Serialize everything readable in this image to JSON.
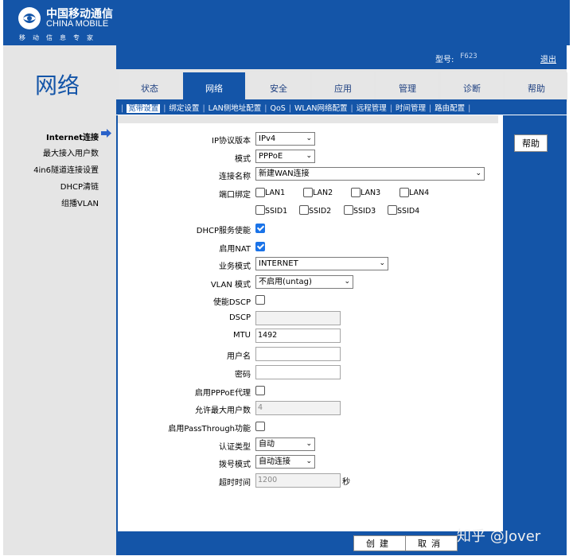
{
  "brand": {
    "name_cn": "中国移动通信",
    "name_en": "CHINA MOBILE",
    "slogan": "移动信息专家"
  },
  "section_title": "网络",
  "header": {
    "model_label": "型号:",
    "model_value": "F623",
    "logout": "退出"
  },
  "tabs": [
    {
      "label": "状态",
      "active": false
    },
    {
      "label": "网络",
      "active": true
    },
    {
      "label": "安全",
      "active": false
    },
    {
      "label": "应用",
      "active": false
    },
    {
      "label": "管理",
      "active": false
    },
    {
      "label": "诊断",
      "active": false
    },
    {
      "label": "帮助",
      "active": false
    }
  ],
  "subnav": [
    "宽带设置",
    "绑定设置",
    "LAN侧地址配置",
    "QoS",
    "WLAN网络配置",
    "远程管理",
    "时间管理",
    "路由配置"
  ],
  "sidebar": [
    {
      "label": "Internet连接",
      "active": true
    },
    {
      "label": "最大接入用户数"
    },
    {
      "label": "4in6隧道连接设置"
    },
    {
      "label": "DHCP清链"
    },
    {
      "label": "组播VLAN"
    }
  ],
  "help_button": "帮助",
  "form": {
    "ip_version": {
      "label": "IP协议版本",
      "value": "IPv4"
    },
    "mode": {
      "label": "模式",
      "value": "PPPoE"
    },
    "conn_name": {
      "label": "连接名称",
      "value": "新建WAN连接"
    },
    "port_binding": {
      "label": "端口绑定",
      "ports": [
        "LAN1",
        "LAN2",
        "LAN3",
        "LAN4"
      ],
      "ssids": [
        "SSID1",
        "SSID2",
        "SSID3",
        "SSID4"
      ]
    },
    "dhcp_service": {
      "label": "DHCP服务使能",
      "checked": true
    },
    "nat": {
      "label": "启用NAT",
      "checked": true
    },
    "service_mode": {
      "label": "业务模式",
      "value": "INTERNET"
    },
    "vlan_mode": {
      "label": "VLAN 模式",
      "value": "不启用(untag)"
    },
    "dscp_enable": {
      "label": "使能DSCP",
      "checked": false
    },
    "dscp": {
      "label": "DSCP",
      "value": ""
    },
    "mtu": {
      "label": "MTU",
      "value": "1492"
    },
    "username": {
      "label": "用户名",
      "value": ""
    },
    "password": {
      "label": "密码",
      "value": ""
    },
    "pppoe_proxy": {
      "label": "启用PPPoE代理",
      "checked": false
    },
    "max_users": {
      "label": "允许最大用户数",
      "value": "4"
    },
    "passthrough": {
      "label": "启用PassThrough功能",
      "checked": false
    },
    "auth_type": {
      "label": "认证类型",
      "value": "自动"
    },
    "dial_mode": {
      "label": "拨号模式",
      "value": "自动连接"
    },
    "timeout": {
      "label": "超时时间",
      "value": "1200",
      "unit": "秒"
    }
  },
  "footer": {
    "create": "创建",
    "cancel": "取消"
  },
  "watermark": "知乎 @Jover",
  "colors": {
    "primary": "#1455a8",
    "panel": "#e5e5e5",
    "check": "#1a73e8"
  }
}
